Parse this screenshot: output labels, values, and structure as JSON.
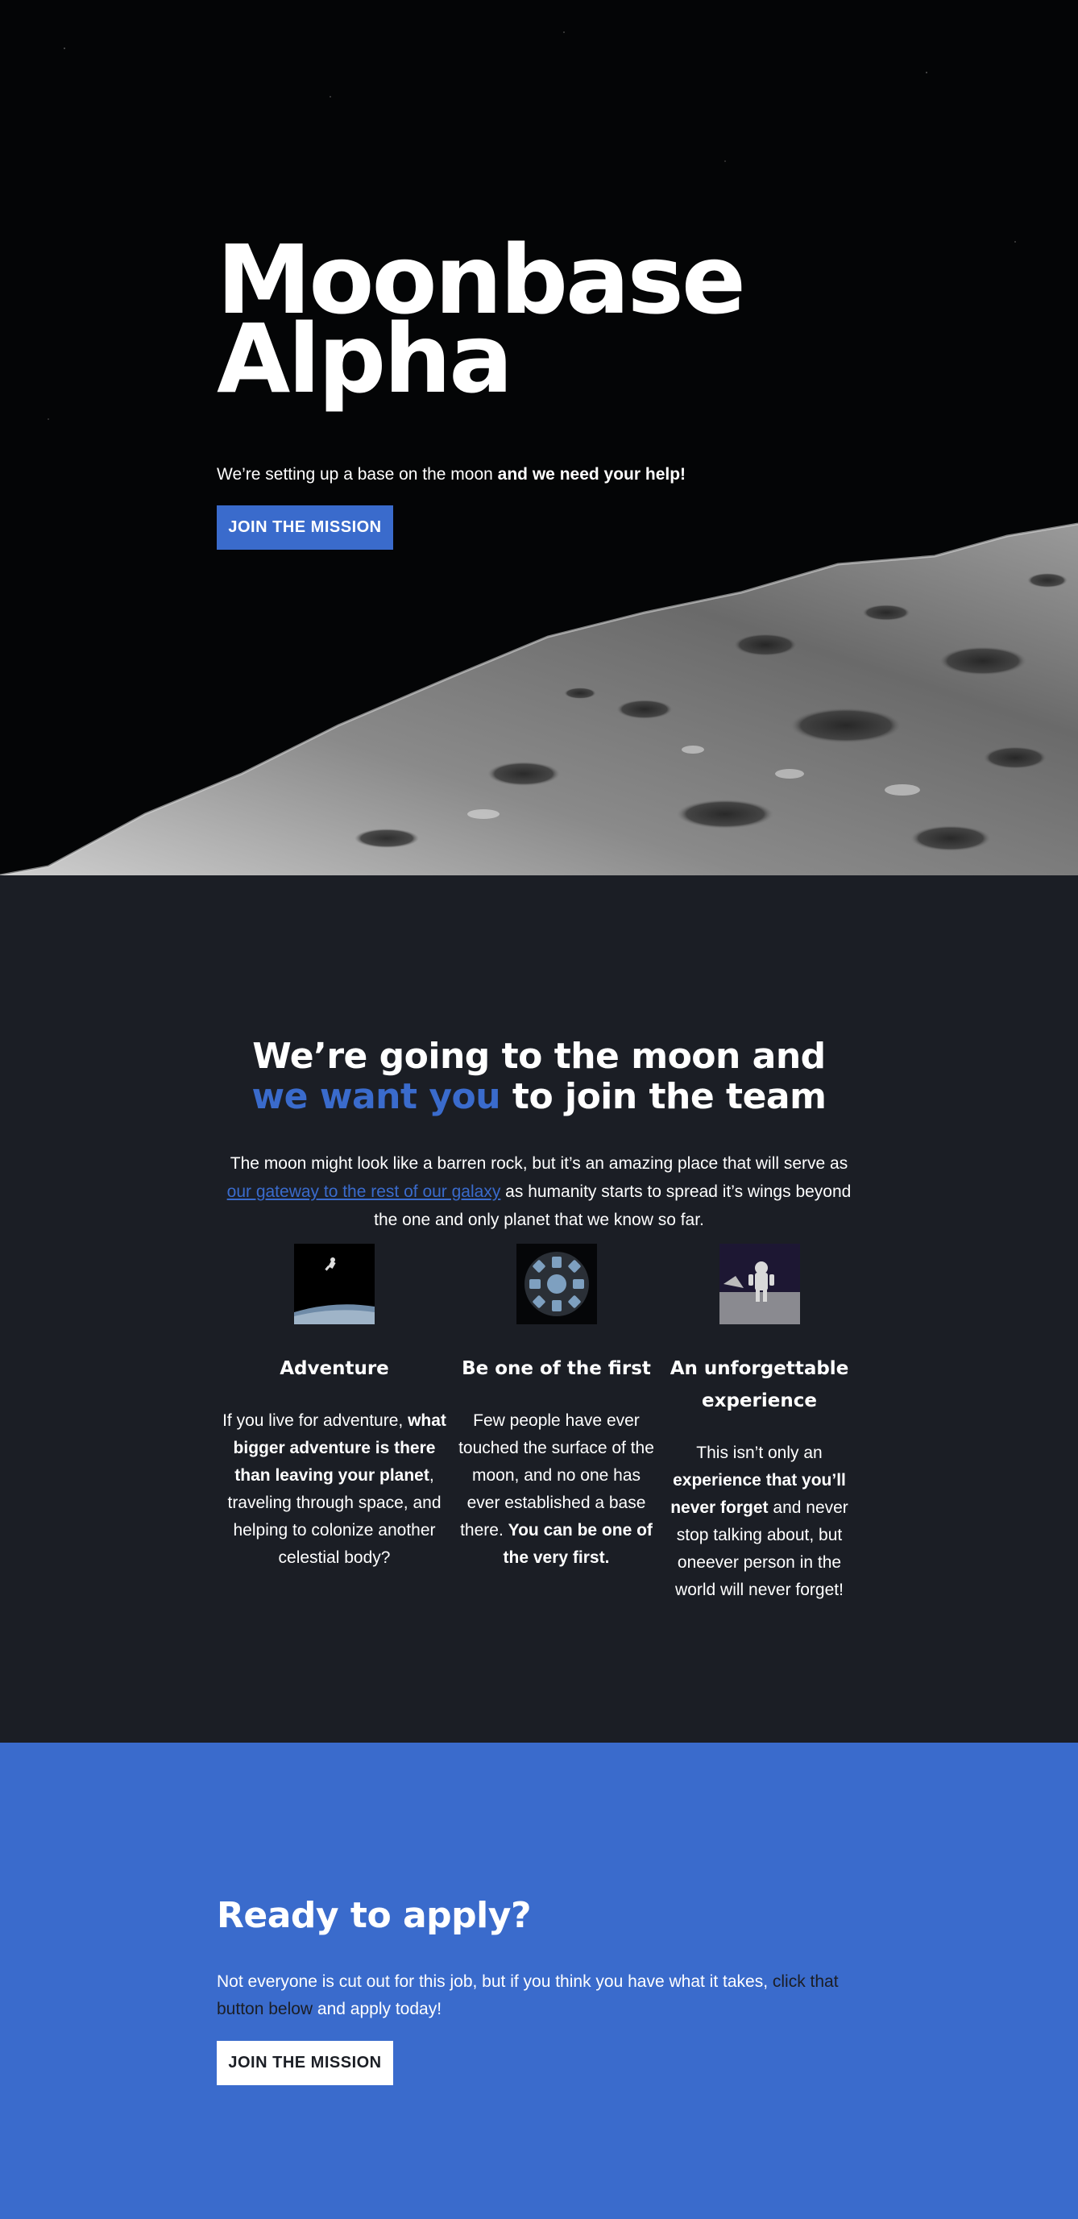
{
  "hero": {
    "title_line1": "Moonbase",
    "title_line2": "Alpha",
    "tagline_plain": "We’re setting up a base on the moon ",
    "tagline_bold": "and we need your help!",
    "cta_label": "JOIN THE MISSION"
  },
  "about": {
    "heading_part1": "We’re going to the moon and ",
    "heading_highlight": "we want you",
    "heading_part2": " to join the team",
    "lead_part1": "The moon might look like a barren rock, but it’s an amazing place that will serve as ",
    "lead_link": "our gateway to the rest of our galaxy",
    "lead_part2": " as humanity starts to spread it’s wings beyond the one and only planet that we know so far.",
    "features": [
      {
        "image": "astronaut-floating-image",
        "title": "Adventure",
        "text_1": "If you live for adventure, ",
        "text_bold_1": "what bigger adventure is there than leaving your planet",
        "text_2": ", traveling through space, and helping to colonize another celestial body?"
      },
      {
        "image": "space-station-window-image",
        "title": "Be one of the first",
        "text_1": "Few people have ever touched the surface of the moon, and no one has ever established a base there. ",
        "text_bold_1": "You can be one of the very first."
      },
      {
        "image": "astronaut-on-moon-image",
        "title": "An unforgettable experience",
        "text_1": "This isn’t only an ",
        "text_bold_1": "experience that you’ll never forget",
        "text_2": " and never stop talking about, but oneever person in the world will never forget!"
      }
    ]
  },
  "apply": {
    "heading": "Ready to apply?",
    "text_part1": "Not everyone is cut out for this job, but if you think you have what it takes, ",
    "text_dark": "click that button below",
    "text_part2": " and apply today!",
    "cta_label": "JOIN THE MISSION"
  },
  "colors": {
    "accent": "#3a6bcc",
    "dark_bg": "#1b1e25",
    "hero_bg": "#040506"
  }
}
